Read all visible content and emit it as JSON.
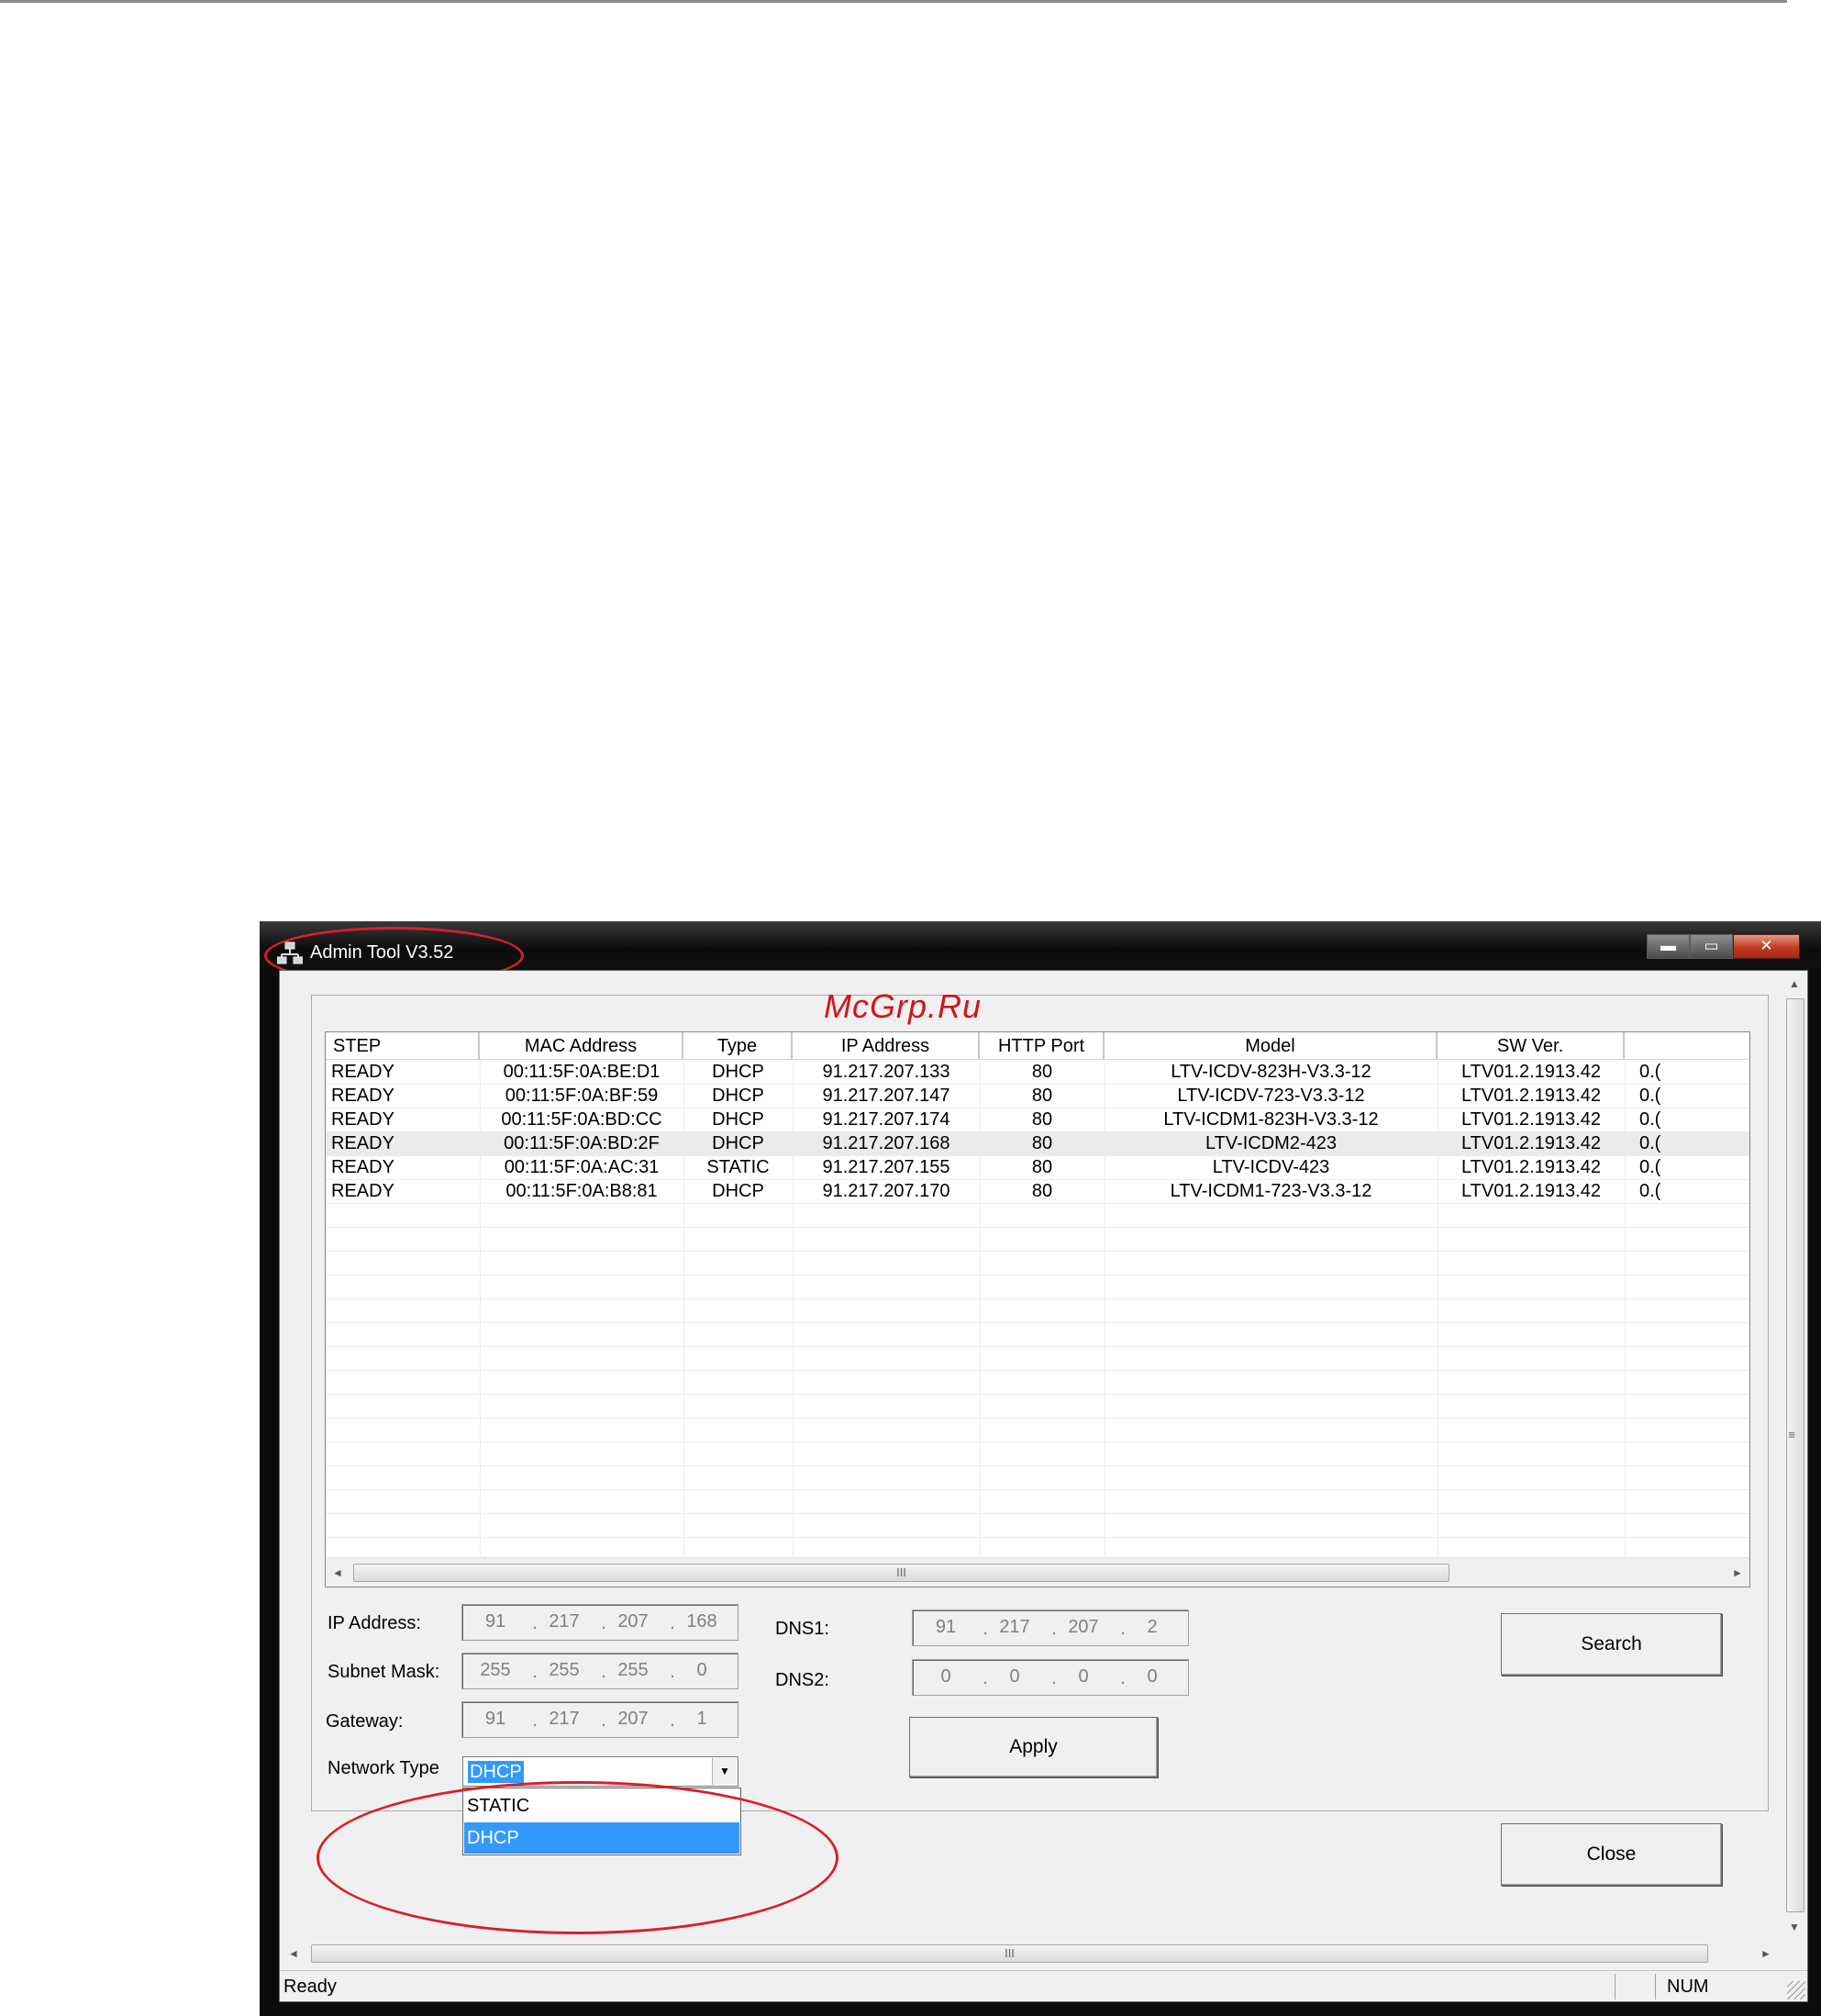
{
  "window": {
    "title": "Admin Tool V3.52",
    "buttons": {
      "minimize": "▬",
      "maximize": "▭",
      "close": "✕"
    }
  },
  "watermark": "McGrp.Ru",
  "table": {
    "columns": [
      "STEP",
      "MAC Address",
      "Type",
      "IP Address",
      "HTTP Port",
      "Model",
      "SW Ver.",
      ""
    ],
    "rows": [
      [
        "READY",
        "00:11:5F:0A:BE:D1",
        "DHCP",
        "91.217.207.133",
        "80",
        "LTV-ICDV-823H-V3.3-12",
        "LTV01.2.1913.42",
        "0.("
      ],
      [
        "READY",
        "00:11:5F:0A:BF:59",
        "DHCP",
        "91.217.207.147",
        "80",
        "LTV-ICDV-723-V3.3-12",
        "LTV01.2.1913.42",
        "0.("
      ],
      [
        "READY",
        "00:11:5F:0A:BD:CC",
        "DHCP",
        "91.217.207.174",
        "80",
        "LTV-ICDM1-823H-V3.3-12",
        "LTV01.2.1913.42",
        "0.("
      ],
      [
        "READY",
        "00:11:5F:0A:BD:2F",
        "DHCP",
        "91.217.207.168",
        "80",
        "LTV-ICDM2-423",
        "LTV01.2.1913.42",
        "0.("
      ],
      [
        "READY",
        "00:11:5F:0A:AC:31",
        "STATIC",
        "91.217.207.155",
        "80",
        "LTV-ICDV-423",
        "LTV01.2.1913.42",
        "0.("
      ],
      [
        "READY",
        "00:11:5F:0A:B8:81",
        "DHCP",
        "91.217.207.170",
        "80",
        "LTV-ICDM1-723-V3.3-12",
        "LTV01.2.1913.42",
        "0.("
      ]
    ],
    "selected_row": 3,
    "scroll_grip": "III"
  },
  "form": {
    "ip_address": {
      "label": "IP Address:",
      "octets": [
        "91",
        "217",
        "207",
        "168"
      ]
    },
    "subnet_mask": {
      "label": "Subnet Mask:",
      "octets": [
        "255",
        "255",
        "255",
        "0"
      ]
    },
    "gateway": {
      "label": "Gateway:",
      "octets": [
        "91",
        "217",
        "207",
        "1"
      ]
    },
    "dns1": {
      "label": "DNS1:",
      "octets": [
        "91",
        "217",
        "207",
        "2"
      ]
    },
    "dns2": {
      "label": "DNS2:",
      "octets": [
        "0",
        "0",
        "0",
        "0"
      ]
    },
    "network_type": {
      "label": "Network Type",
      "value": "DHCP",
      "options": [
        "STATIC",
        "DHCP"
      ],
      "highlighted_option": 1
    },
    "separator": "."
  },
  "buttons": {
    "search": "Search",
    "apply": "Apply",
    "close": "Close"
  },
  "status": {
    "text": "Ready",
    "num": "NUM"
  },
  "icons": {
    "scroll_up": "▲",
    "scroll_down": "▼",
    "scroll_left": "◄",
    "scroll_right": "►",
    "dropdown": "▼",
    "vertical_grip": "≡"
  },
  "colors": {
    "annotation": "#d8202a",
    "selection": "#3399ff",
    "watermark": "#d2141c"
  }
}
